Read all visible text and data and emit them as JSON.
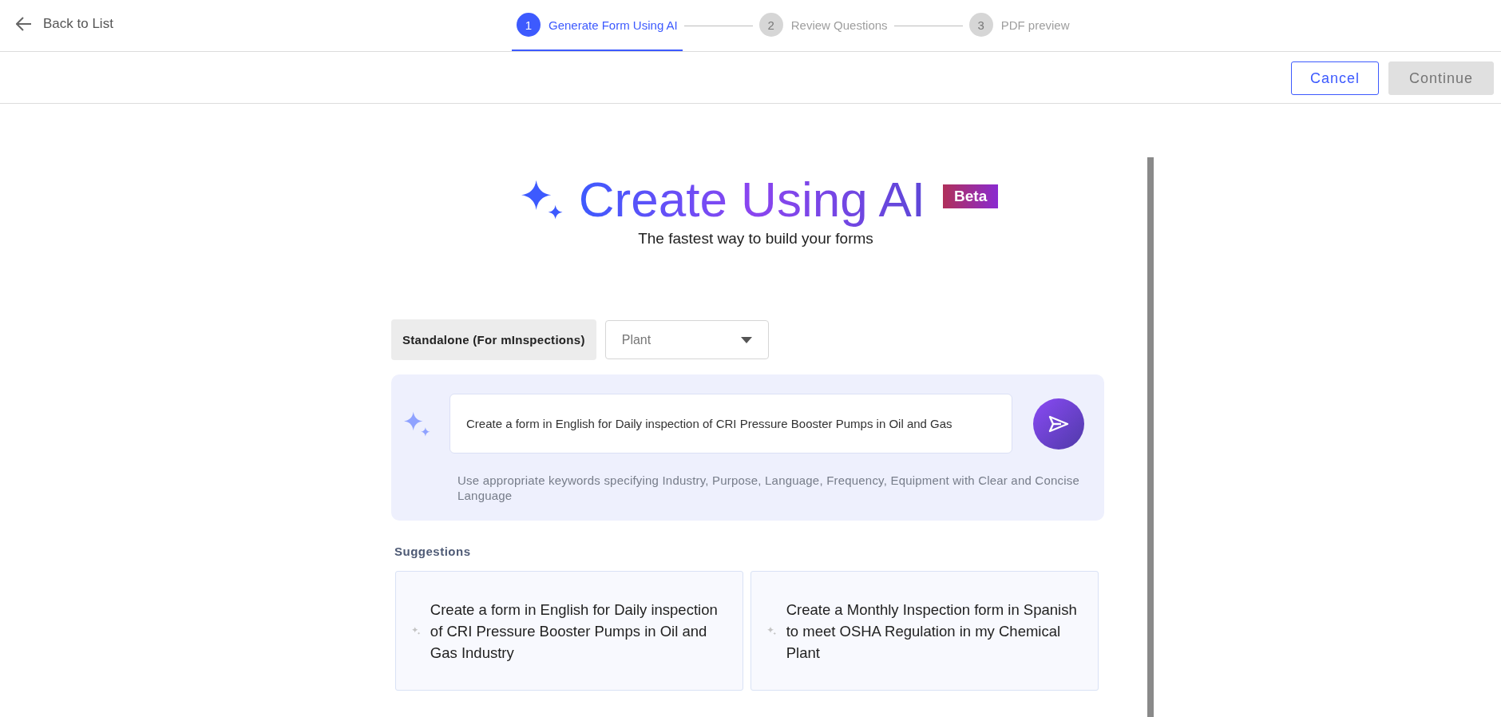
{
  "header": {
    "back_link": "Back to List",
    "steps": [
      {
        "number": "1",
        "label": "Generate Form Using AI",
        "selected": true
      },
      {
        "number": "2",
        "label": "Review Questions",
        "selected": false
      },
      {
        "number": "3",
        "label": "PDF preview",
        "selected": false
      }
    ]
  },
  "actions": [
    {
      "label": "Cancel",
      "kind": "outline",
      "disabled": false
    },
    {
      "label": "Continue",
      "kind": "primary",
      "disabled": true
    }
  ],
  "hero": {
    "title": "Create Using AI",
    "badge": "Beta",
    "subtitle": "The fastest way to build your forms"
  },
  "mode": {
    "label": "Standalone (For mInspections)",
    "dropdown_value": "Plant"
  },
  "prompt": {
    "value": "Create a form in English for Daily inspection of CRI Pressure Booster Pumps in Oil and Gas",
    "hint": "Use appropriate keywords specifying Industry, Purpose, Language, Frequency, Equipment with Clear and Concise Language"
  },
  "suggestions": {
    "label": "Suggestions",
    "items": [
      "Create a form in English for Daily inspection of CRI Pressure Booster Pumps in Oil and Gas Industry",
      "Create a Monthly Inspection form in Spanish to meet OSHA Regulation in my Chemical Plant"
    ]
  }
}
